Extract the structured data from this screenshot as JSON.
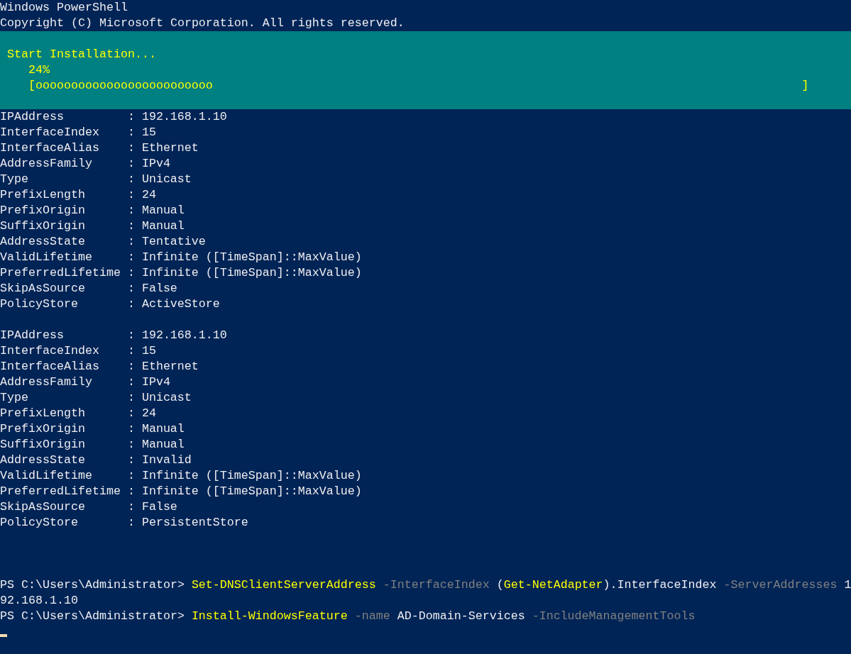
{
  "header": [
    "Windows PowerShell",
    "Copyright (C) Microsoft Corporation. All rights reserved."
  ],
  "progress": {
    "title": "Start Installation...",
    "percent": "24%",
    "open_bracket": "[",
    "fill": "ooooooooooooooooooooooooo",
    "close_bracket": "]"
  },
  "property_separator": ":",
  "records": [
    [
      {
        "key": "IPAddress",
        "value": "192.168.1.10"
      },
      {
        "key": "InterfaceIndex",
        "value": "15"
      },
      {
        "key": "InterfaceAlias",
        "value": "Ethernet"
      },
      {
        "key": "AddressFamily",
        "value": "IPv4"
      },
      {
        "key": "Type",
        "value": "Unicast"
      },
      {
        "key": "PrefixLength",
        "value": "24"
      },
      {
        "key": "PrefixOrigin",
        "value": "Manual"
      },
      {
        "key": "SuffixOrigin",
        "value": "Manual"
      },
      {
        "key": "AddressState",
        "value": "Tentative"
      },
      {
        "key": "ValidLifetime",
        "value": "Infinite ([TimeSpan]::MaxValue)"
      },
      {
        "key": "PreferredLifetime",
        "value": "Infinite ([TimeSpan]::MaxValue)"
      },
      {
        "key": "SkipAsSource",
        "value": "False"
      },
      {
        "key": "PolicyStore",
        "value": "ActiveStore"
      }
    ],
    [
      {
        "key": "IPAddress",
        "value": "192.168.1.10"
      },
      {
        "key": "InterfaceIndex",
        "value": "15"
      },
      {
        "key": "InterfaceAlias",
        "value": "Ethernet"
      },
      {
        "key": "AddressFamily",
        "value": "IPv4"
      },
      {
        "key": "Type",
        "value": "Unicast"
      },
      {
        "key": "PrefixLength",
        "value": "24"
      },
      {
        "key": "PrefixOrigin",
        "value": "Manual"
      },
      {
        "key": "SuffixOrigin",
        "value": "Manual"
      },
      {
        "key": "AddressState",
        "value": "Invalid"
      },
      {
        "key": "ValidLifetime",
        "value": "Infinite ([TimeSpan]::MaxValue)"
      },
      {
        "key": "PreferredLifetime",
        "value": "Infinite ([TimeSpan]::MaxValue)"
      },
      {
        "key": "SkipAsSource",
        "value": "False"
      },
      {
        "key": "PolicyStore",
        "value": "PersistentStore"
      }
    ]
  ],
  "console_lines": [
    {
      "words": [
        [
          {
            "kind": "prompt",
            "text": "PS C:\\Users\\Administrator>"
          }
        ],
        [
          {
            "kind": "command",
            "text": "Set-DNSClientServerAddress"
          }
        ],
        [
          {
            "kind": "parameter",
            "text": "-InterfaceIndex"
          }
        ],
        [
          {
            "kind": "argument",
            "text": "("
          },
          {
            "kind": "command",
            "text": "Get-NetAdapter"
          },
          {
            "kind": "argument",
            "text": ").InterfaceIndex"
          }
        ],
        [
          {
            "kind": "parameter",
            "text": "-ServerAddresses"
          }
        ],
        [
          {
            "kind": "argument",
            "text": "1"
          }
        ]
      ]
    },
    {
      "words": [
        [
          {
            "kind": "argument",
            "text": "92.168.1.10"
          }
        ]
      ]
    },
    {
      "words": [
        [
          {
            "kind": "prompt",
            "text": "PS C:\\Users\\Administrator>"
          }
        ],
        [
          {
            "kind": "command",
            "text": "Install-WindowsFeature"
          }
        ],
        [
          {
            "kind": "parameter",
            "text": "-name"
          }
        ],
        [
          {
            "kind": "argument",
            "text": "AD-Domain-Services"
          }
        ],
        [
          {
            "kind": "parameter",
            "text": "-IncludeManagementTools"
          }
        ]
      ]
    }
  ],
  "cursor_visible": true
}
